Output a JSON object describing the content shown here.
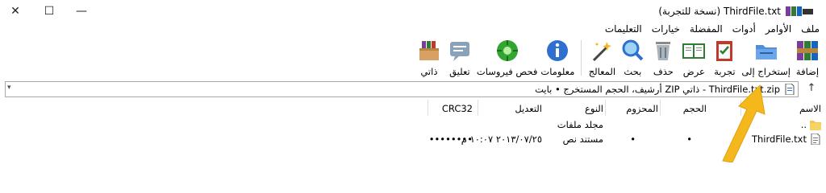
{
  "titlebar": {
    "title": "ThirdFile.txt (نسخة للتجربة)",
    "minimize": "—",
    "maximize": "☐",
    "close": "✕"
  },
  "menu": [
    "ملف",
    "الأوامر",
    "أدوات",
    "المفضلة",
    "خيارات",
    "التعليمات"
  ],
  "toolbar": [
    {
      "label": "إضافة",
      "icon": "add-archive-icon"
    },
    {
      "label": "إستخراج إلى",
      "icon": "extract-folder-icon"
    },
    {
      "label": "تجربة",
      "icon": "test-clipboard-icon"
    },
    {
      "label": "عرض",
      "icon": "view-book-icon"
    },
    {
      "label": "حذف",
      "icon": "trash-icon"
    },
    {
      "label": "بحث",
      "icon": "search-magnifier-icon"
    },
    {
      "label": "المعالج",
      "icon": "wizard-wand-icon"
    },
    {
      "label": "معلومات",
      "icon": "info-icon"
    },
    {
      "label": "فحص فيروسات",
      "icon": "virus-scan-icon"
    },
    {
      "label": "تعليق",
      "icon": "comment-icon"
    },
    {
      "label": "ذاتي",
      "icon": "sfx-box-icon"
    }
  ],
  "address": {
    "text": "ThirdFile.txt.zip - ذاتي ZIP أرشيف، الحجم المستخرج • بايت"
  },
  "columns": [
    "الاسم",
    "الحجم",
    "المحزوم",
    "النوع",
    "التعديل",
    "CRC32"
  ],
  "rows": [
    {
      "name": "..",
      "size": "",
      "packed": "",
      "type": "مجلد ملفات",
      "modified": "",
      "crc": "",
      "icon": "folder-icon"
    },
    {
      "name": "ThirdFile.txt",
      "size": "•",
      "packed": "•",
      "type": "مستند نص",
      "modified": "٢٠١٣/٠٧/٢٥ ١٠:٠٧ م",
      "crc": "••••••••",
      "icon": "text-file-icon"
    }
  ],
  "colors": {
    "arrow": "#f5b81c",
    "folder": "#f2c94c",
    "info": "#2f6fcf",
    "virus": "#33a532"
  }
}
